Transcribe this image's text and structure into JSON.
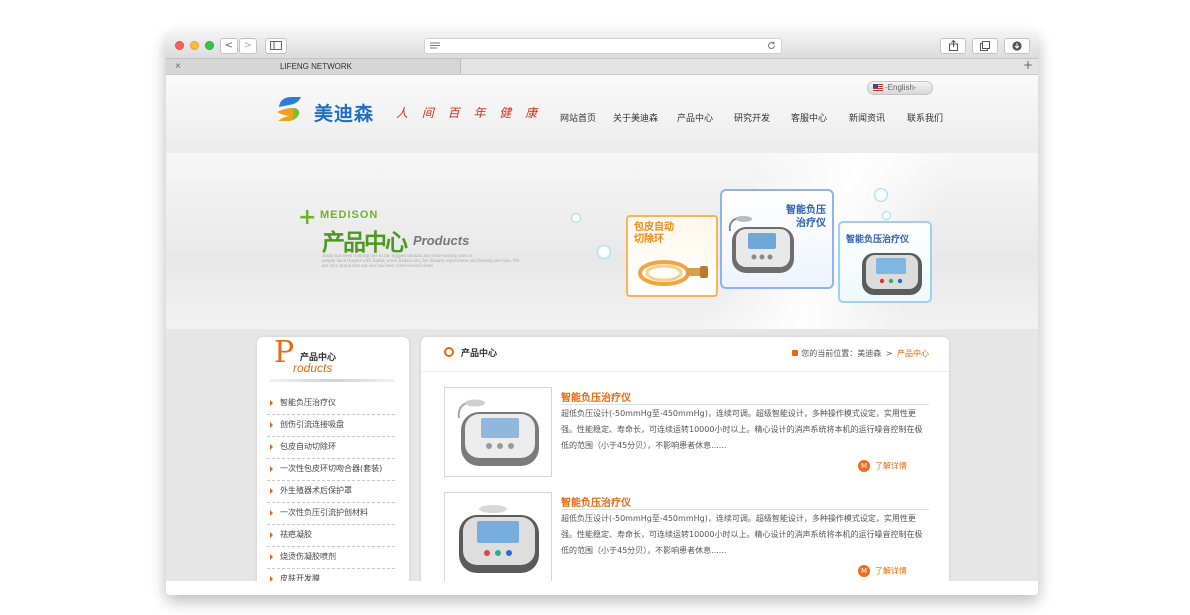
{
  "browser": {
    "tab_title": "LIFENG NETWORK",
    "tab_close": "×",
    "new_tab": "+",
    "back": "<",
    "forward": ">"
  },
  "header": {
    "brand_name": "美迪森",
    "slogan": "人 间 百 年 健 康",
    "language_link": "-English-",
    "nav": [
      "网站首页",
      "关于美迪森",
      "产品中心",
      "研究开发",
      "客服中心",
      "新闻资讯",
      "联系我们"
    ]
  },
  "banner": {
    "plus": "+",
    "en_brand": "MEDISON",
    "cn_title": "产品中心",
    "en_title": "Products",
    "small_text_1": "Jiadal has been running one of the biggest domain and well-hosting sites in",
    "small_text_2": "people have trusted with Jiadal, www.Jiadal.com, for domain registration and hosting services. We",
    "small_text_3": "are very proud that our site has been cited several times",
    "card1_label": "包皮自动切除环",
    "card2_label": "智能负压治疗仪",
    "card3_label": "智能负压治疗仪"
  },
  "sidebar": {
    "big_letter": "P",
    "title_cn": "产品中心",
    "title_en": "roducts",
    "items": [
      "智能负压治疗仪",
      "创伤引流连接吸盘",
      "包皮自动切除环",
      "一次性包皮环切吻合器(套装)",
      "外生殖器术后保护罩",
      "一次性负压引流护创材料",
      "祛疤凝胶",
      "烧烫伤凝胶喷剂",
      "皮肤开发膜"
    ]
  },
  "main": {
    "heading": "产品中心",
    "breadcrumb_prefix": "您的当前位置：",
    "breadcrumb_home": "美迪森",
    "breadcrumb_sep": ">",
    "breadcrumb_current": "产品中心",
    "products": [
      {
        "title": "智能负压治疗仪",
        "desc": "超低负压设计(-50mmHg至-450mmHg)，连续可调。超级智能设计，多种操作模式设定，实用性更强。性能稳定、寿命长，可连续运转10000小时以上。精心设计的消声系统将本机的运行噪音控制在极低的范围（小于45分贝），不影响患者休息......",
        "more": "了解详情",
        "more_icon": "M"
      },
      {
        "title": "智能负压治疗仪",
        "desc": "超低负压设计(-50mmHg至-450mmHg)，连续可调。超级智能设计，多种操作模式设定，实用性更强。性能稳定、寿命长，可连续运转10000小时以上。精心设计的消声系统将本机的运行噪音控制在极低的范围（小于45分贝），不影响患者休息......",
        "more": "了解详情",
        "more_icon": "M"
      }
    ]
  },
  "colors": {
    "accent": "#e56a12",
    "brand_blue": "#1f6fc7"
  }
}
